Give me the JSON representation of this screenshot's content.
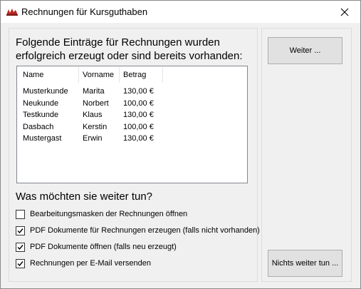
{
  "window": {
    "title": "Rechnungen für Kursguthaben",
    "app_icon": "app-logo-icon",
    "close_icon": "close-icon"
  },
  "intro_text": "Folgende Einträge für Rechnungen wurden erfolgreich erzeugt oder sind bereits vorhanden:",
  "table": {
    "columns": [
      "Name",
      "Vorname",
      "Betrag"
    ],
    "rows": [
      [
        "Musterkunde",
        "Marita",
        "130,00 €"
      ],
      [
        "Neukunde",
        "Norbert",
        "100,00 €"
      ],
      [
        "Testkunde",
        "Klaus",
        "130,00 €"
      ],
      [
        "Dasbach",
        "Kerstin",
        "100,00 €"
      ],
      [
        "Mustergast",
        "Erwin",
        "130,00 €"
      ]
    ]
  },
  "question": "Was möchten sie weiter tun?",
  "options": [
    {
      "label": "Bearbeitungsmasken der Rechnungen öffnen",
      "checked": false
    },
    {
      "label": "PDF Dokumente für Rechnungen erzeugen (falls nicht vorhanden)",
      "checked": true
    },
    {
      "label": "PDF Dokumente öffnen (falls neu erzeugt)",
      "checked": true
    },
    {
      "label": "Rechnungen per E-Mail versenden",
      "checked": true
    }
  ],
  "buttons": {
    "next": "Weiter ...",
    "nothing": "Nichts weiter tun ..."
  }
}
